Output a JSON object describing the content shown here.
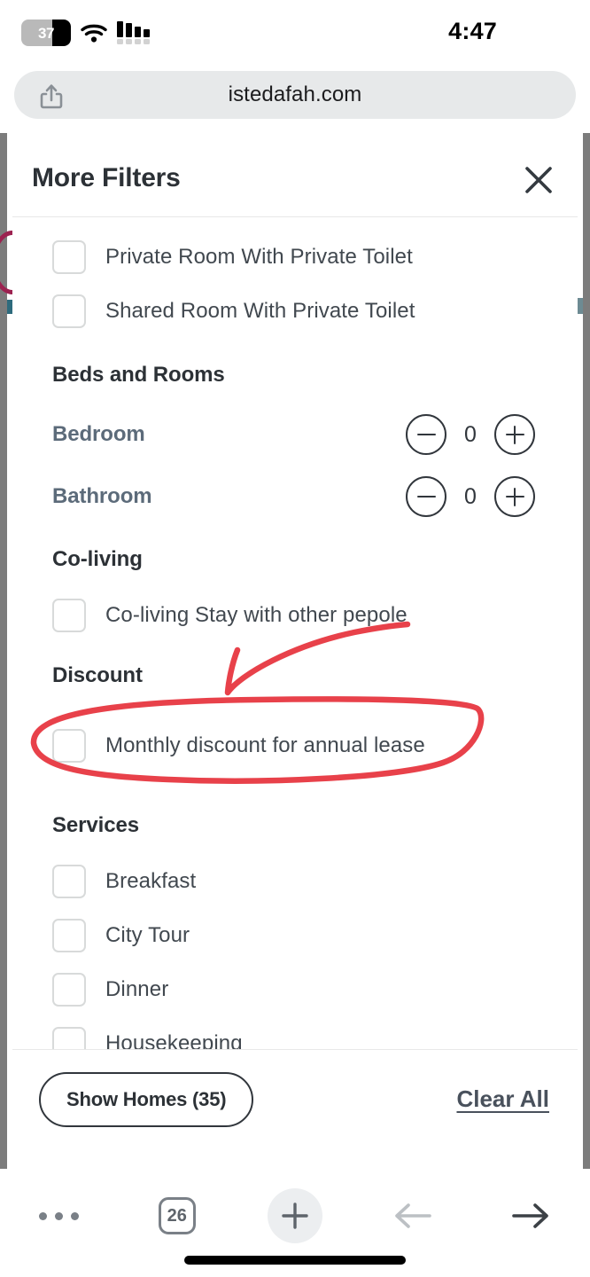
{
  "status_bar": {
    "battery_percent": "37",
    "time": "4:47",
    "wifi_icon": "wifi-icon",
    "signal_icon": "cellular-signal-icon",
    "battery_icon": "battery-icon"
  },
  "browser": {
    "url": "istedafah.com",
    "share_icon": "share-icon",
    "toolbar": {
      "more_icon": "more-dots-icon",
      "tab_count": "26",
      "new_tab_icon": "plus-icon",
      "back_icon": "arrow-left-icon",
      "forward_icon": "arrow-right-icon"
    }
  },
  "modal": {
    "title": "More Filters",
    "close_icon": "close-x-icon",
    "items": [
      {
        "type": "checkbox",
        "label": "Private Room With Private Toilet",
        "checked": false
      },
      {
        "type": "checkbox",
        "label": "Shared Room With Private Toilet",
        "checked": false
      }
    ],
    "sections": [
      {
        "heading": "Beds and Rooms",
        "steppers": [
          {
            "label": "Bedroom",
            "value": "0",
            "minus_icon": "minus-icon",
            "plus_icon": "plus-icon"
          },
          {
            "label": "Bathroom",
            "value": "0",
            "minus_icon": "minus-icon",
            "plus_icon": "plus-icon"
          }
        ]
      },
      {
        "heading": "Co-living",
        "checkboxes": [
          {
            "label": "Co-living Stay with other pepole",
            "checked": false
          }
        ]
      },
      {
        "heading": "Discount",
        "checkboxes": [
          {
            "label": "Monthly discount for annual lease",
            "checked": false
          }
        ]
      },
      {
        "heading": "Services",
        "checkboxes": [
          {
            "label": "Breakfast",
            "checked": false
          },
          {
            "label": "City Tour",
            "checked": false
          },
          {
            "label": "Dinner",
            "checked": false
          },
          {
            "label": "Housekeeping",
            "checked": false
          }
        ]
      }
    ],
    "footer": {
      "show_homes_label": "Show Homes (35)",
      "clear_all_label": "Clear All"
    }
  },
  "annotation": {
    "color": "#e8414a",
    "shapes": [
      "ellipse-around-monthly-discount",
      "arrow-pointing-to-discount"
    ]
  },
  "colors": {
    "accent_heading": "#2c3136",
    "stepper_label": "#5c6b7a",
    "backdrop": "#7c7c7c",
    "annotation_red": "#e8414a",
    "urlbar_bg": "#e7e9ea"
  }
}
